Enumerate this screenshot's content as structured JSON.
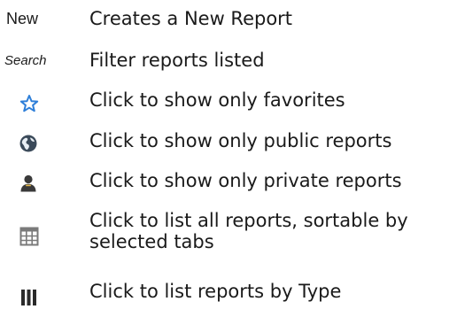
{
  "legend": {
    "rows": [
      {
        "symbol_label": "New",
        "symbol_icon": null,
        "description": "Creates a New Report"
      },
      {
        "symbol_label": "Search",
        "symbol_icon": null,
        "description": "Filter reports listed"
      },
      {
        "symbol_label": null,
        "symbol_icon": "star-outline-icon",
        "description": "Click to show only favorites"
      },
      {
        "symbol_label": null,
        "symbol_icon": "globe-icon",
        "description": "Click to show only public reports"
      },
      {
        "symbol_label": null,
        "symbol_icon": "person-icon",
        "description": "Click to show only private reports"
      },
      {
        "symbol_label": null,
        "symbol_icon": "grid-table-icon",
        "description": "Click to list all reports, sortable by selected tabs"
      },
      {
        "symbol_label": null,
        "symbol_icon": "columns-icon",
        "description": "Click to list reports by Type"
      }
    ]
  },
  "colors": {
    "text": "#1a1a1a",
    "star_blue": "#2e7fd9",
    "globe_dark": "#3b4a5a",
    "person_dark": "#3a3a3a",
    "grid_gray": "#7a7a7a"
  }
}
